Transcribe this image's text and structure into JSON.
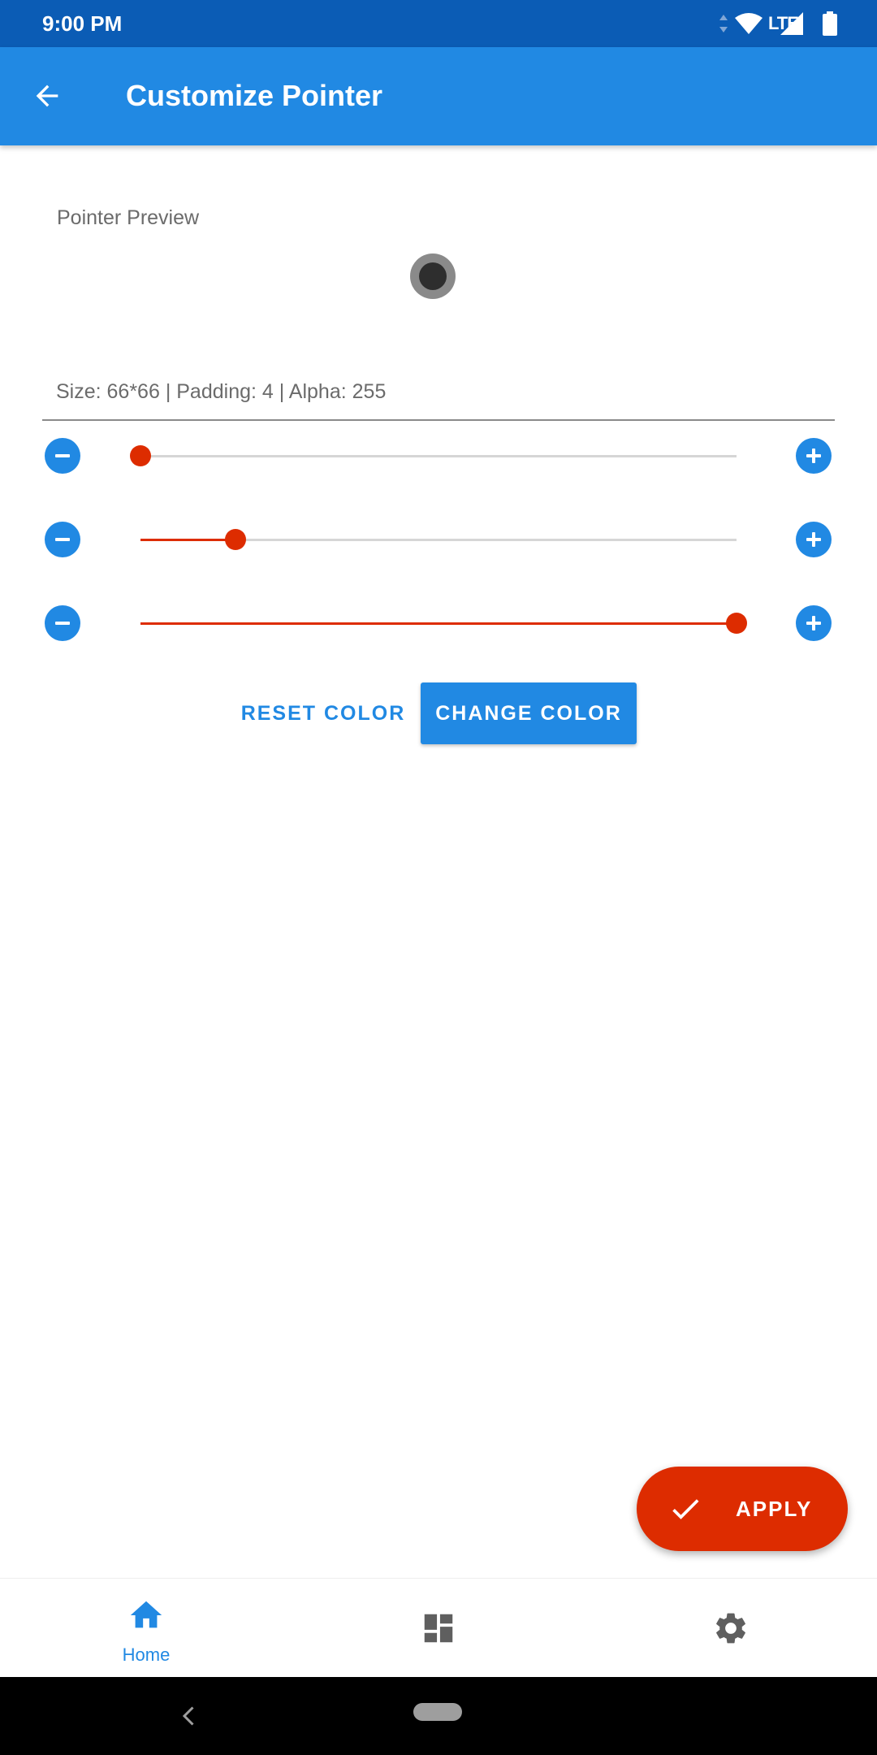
{
  "status_bar": {
    "time": "9:00 PM",
    "network": "LTE",
    "icons": [
      "data-arrows-icon",
      "wifi-icon",
      "cell-signal-icon",
      "battery-icon"
    ]
  },
  "app_bar": {
    "title": "Customize Pointer",
    "back_icon": "arrow-back-icon"
  },
  "preview": {
    "label": "Pointer Preview",
    "pointer_outer_color": "#8a8a8a",
    "pointer_inner_color": "#2e2e2e"
  },
  "info": {
    "text": "Size: 66*66 | Padding: 4 | Alpha: 255"
  },
  "sliders": [
    {
      "name": "size",
      "fraction": 0.0
    },
    {
      "name": "padding",
      "fraction": 0.16
    },
    {
      "name": "alpha",
      "fraction": 1.0
    }
  ],
  "buttons": {
    "reset_color": "RESET COLOR",
    "change_color": "CHANGE COLOR"
  },
  "fab": {
    "label": "APPLY",
    "icon": "check-icon"
  },
  "bottom_nav": {
    "items": [
      {
        "label": "Home",
        "icon": "home-icon",
        "selected": true
      },
      {
        "label": "",
        "icon": "dashboard-icon",
        "selected": false
      },
      {
        "label": "",
        "icon": "settings-icon",
        "selected": false
      }
    ]
  },
  "colors": {
    "primary": "#2189e3",
    "primary_dark": "#0b5cb5",
    "accent": "#dd2c00",
    "track": "#d6d6d6",
    "icon_gray": "#5f5f5f"
  }
}
